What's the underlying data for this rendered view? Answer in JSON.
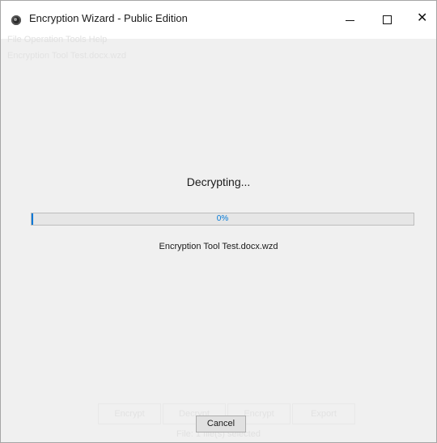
{
  "window": {
    "title": "Encryption Wizard - Public Edition",
    "controls": {
      "minimize": "minimize",
      "maximize": "maximize",
      "close": "✕"
    }
  },
  "background_app": {
    "menu": "File  Operation  Tools  Help",
    "tab": "Encryption Tool Test.docx.wzd",
    "actions": [
      "Encrypt",
      "Decrypt",
      "Encrypt",
      "Export"
    ],
    "status": "File: 1 file(s) selected"
  },
  "dialog": {
    "heading": "Decrypting...",
    "progress": {
      "value": 0,
      "label": "0%"
    },
    "file_name": "Encryption Tool Test.docx.wzd",
    "cancel_label": "Cancel"
  },
  "colors": {
    "accent": "#0078d7",
    "window_bg": "#f0f0f0",
    "button_bg": "#e1e1e1"
  }
}
